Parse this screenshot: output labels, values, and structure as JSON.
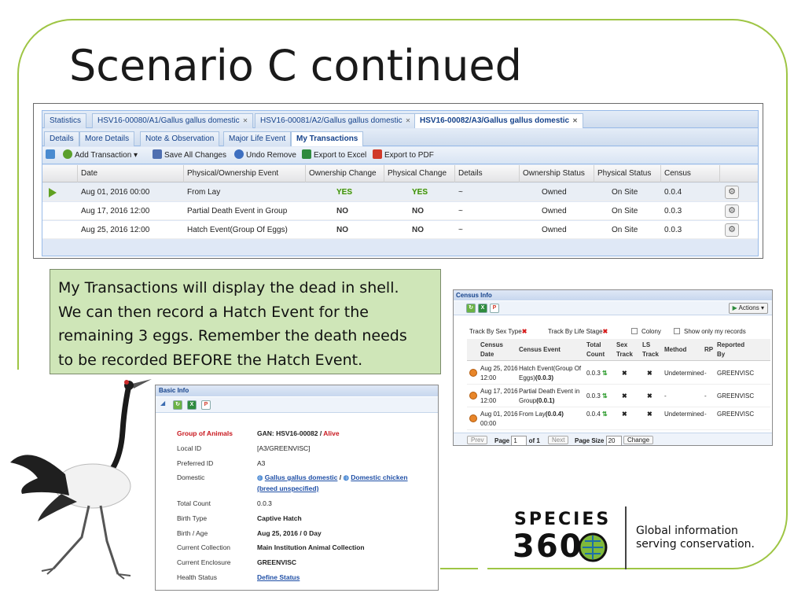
{
  "slide": {
    "title": "Scenario C continued"
  },
  "tabs": {
    "top": [
      {
        "label": "Statistics"
      },
      {
        "label": "HSV16-00080/A1/Gallus gallus domestic"
      },
      {
        "label": "HSV16-00081/A2/Gallus gallus domestic"
      },
      {
        "label": "HSV16-00082/A3/Gallus gallus domestic"
      }
    ],
    "sub": [
      {
        "label": "Details"
      },
      {
        "label": "More Details"
      },
      {
        "label": "Note & Observation"
      },
      {
        "label": "Major Life Event"
      },
      {
        "label": "My Transactions"
      }
    ]
  },
  "toolbar": {
    "add_transaction": "Add Transaction",
    "save_all": "Save All Changes",
    "undo_remove": "Undo Remove",
    "export_excel": "Export to Excel",
    "export_pdf": "Export to PDF"
  },
  "grid": {
    "columns": [
      "Date",
      "Physical/Ownership Event",
      "Ownership Change",
      "Physical Change",
      "Details",
      "Ownership Status",
      "Physical Status",
      "Census"
    ],
    "rows": [
      {
        "date": "Aug 01, 2016 00:00",
        "event": "From Lay",
        "own_change": "YES",
        "phys_change": "YES",
        "details": "~",
        "own_status": "Owned",
        "phys_status": "On Site",
        "census": "0.0.4"
      },
      {
        "date": "Aug 17, 2016 12:00",
        "event": "Partial Death Event in Group",
        "own_change": "NO",
        "phys_change": "NO",
        "details": "~",
        "own_status": "Owned",
        "phys_status": "On Site",
        "census": "0.0.3"
      },
      {
        "date": "Aug 25, 2016 12:00",
        "event": "Hatch Event(Group Of Eggs)",
        "own_change": "NO",
        "phys_change": "NO",
        "details": "~",
        "own_status": "Owned",
        "phys_status": "On Site",
        "census": "0.0.3"
      }
    ]
  },
  "note": {
    "lines": [
      "My Transactions will display the dead in shell.",
      "We can then record a Hatch Event for the",
      "remaining 3 eggs. Remember the death needs",
      "to be recorded BEFORE the Hatch Event."
    ]
  },
  "census": {
    "title": "Census Info",
    "actions": "Actions",
    "filter_sex": "Track By Sex Type",
    "filter_life": "Track By Life Stage",
    "colony": "Colony",
    "show_mine": "Show only my records",
    "headers": {
      "date1": "Census",
      "date2": "Date",
      "event": "Census Event",
      "total1": "Total",
      "total2": "Count",
      "sex1": "Sex",
      "sex2": "Track",
      "ls1": "LS",
      "ls2": "Track",
      "method": "Method",
      "rp": "RP",
      "rep1": "Reported",
      "rep2": "By"
    },
    "rows": [
      {
        "date1": "Aug 25, 2016",
        "date2": "12:00",
        "event1": "Hatch Event(Group Of",
        "event2": "Eggs)",
        "event_count": "(0.0.3)",
        "total": "0.0.3",
        "method": "Undetermined",
        "rp": "-",
        "reported_by": "GREENVISC"
      },
      {
        "date1": "Aug 17, 2016",
        "date2": "12:00",
        "event1": "Partial Death Event in",
        "event2": "Group",
        "event_count": "(0.0.1)",
        "total": "0.0.3",
        "method": "-",
        "rp": "-",
        "reported_by": "GREENVISC"
      },
      {
        "date1": "Aug 01, 2016",
        "date2": "00:00",
        "event1": "From Lay",
        "event2": "",
        "event_count": "(0.0.4)",
        "total": "0.0.4",
        "method": "Undetermined",
        "rp": "-",
        "reported_by": "GREENVISC"
      }
    ],
    "pager": {
      "prev": "Prev",
      "page": "Page",
      "page_value": "1",
      "of": "of 1",
      "next": "Next",
      "page_size": "Page Size",
      "page_size_value": "20",
      "change": "Change"
    }
  },
  "basic": {
    "title": "Basic Info",
    "fields": [
      {
        "label": "Group of Animals",
        "value": "GAN: HSV16-00082 / ",
        "status": "Alive"
      },
      {
        "label": "Local ID",
        "value": "[A3/GREENVISC]"
      },
      {
        "label": "Preferred ID",
        "value": "A3"
      },
      {
        "label": "Domestic",
        "value": "Gallus gallus domestic",
        "sep": " / ",
        "value2": "Domestic chicken",
        "value3": "(breed unspecified)"
      },
      {
        "label": "Total Count",
        "value": "0.0.3"
      },
      {
        "label": "Birth Type",
        "value": "Captive Hatch"
      },
      {
        "label": "Birth / Age",
        "value": "Aug 25, 2016 / 0 Day"
      },
      {
        "label": "Current Collection",
        "value": "Main Institution Animal Collection"
      },
      {
        "label": "Current Enclosure",
        "value": "GREENVISC"
      },
      {
        "label": "Health Status",
        "value": "Define Status"
      }
    ]
  },
  "logo": {
    "line1": "SPECIES",
    "line2": "360",
    "tagline1": "Global information",
    "tagline2": "serving conservation."
  },
  "colors": {
    "accent_green": "#9ec544",
    "note_bg": "#cfe6b8",
    "alive_red": "#c8171e",
    "link_blue": "#1f4fa6"
  }
}
